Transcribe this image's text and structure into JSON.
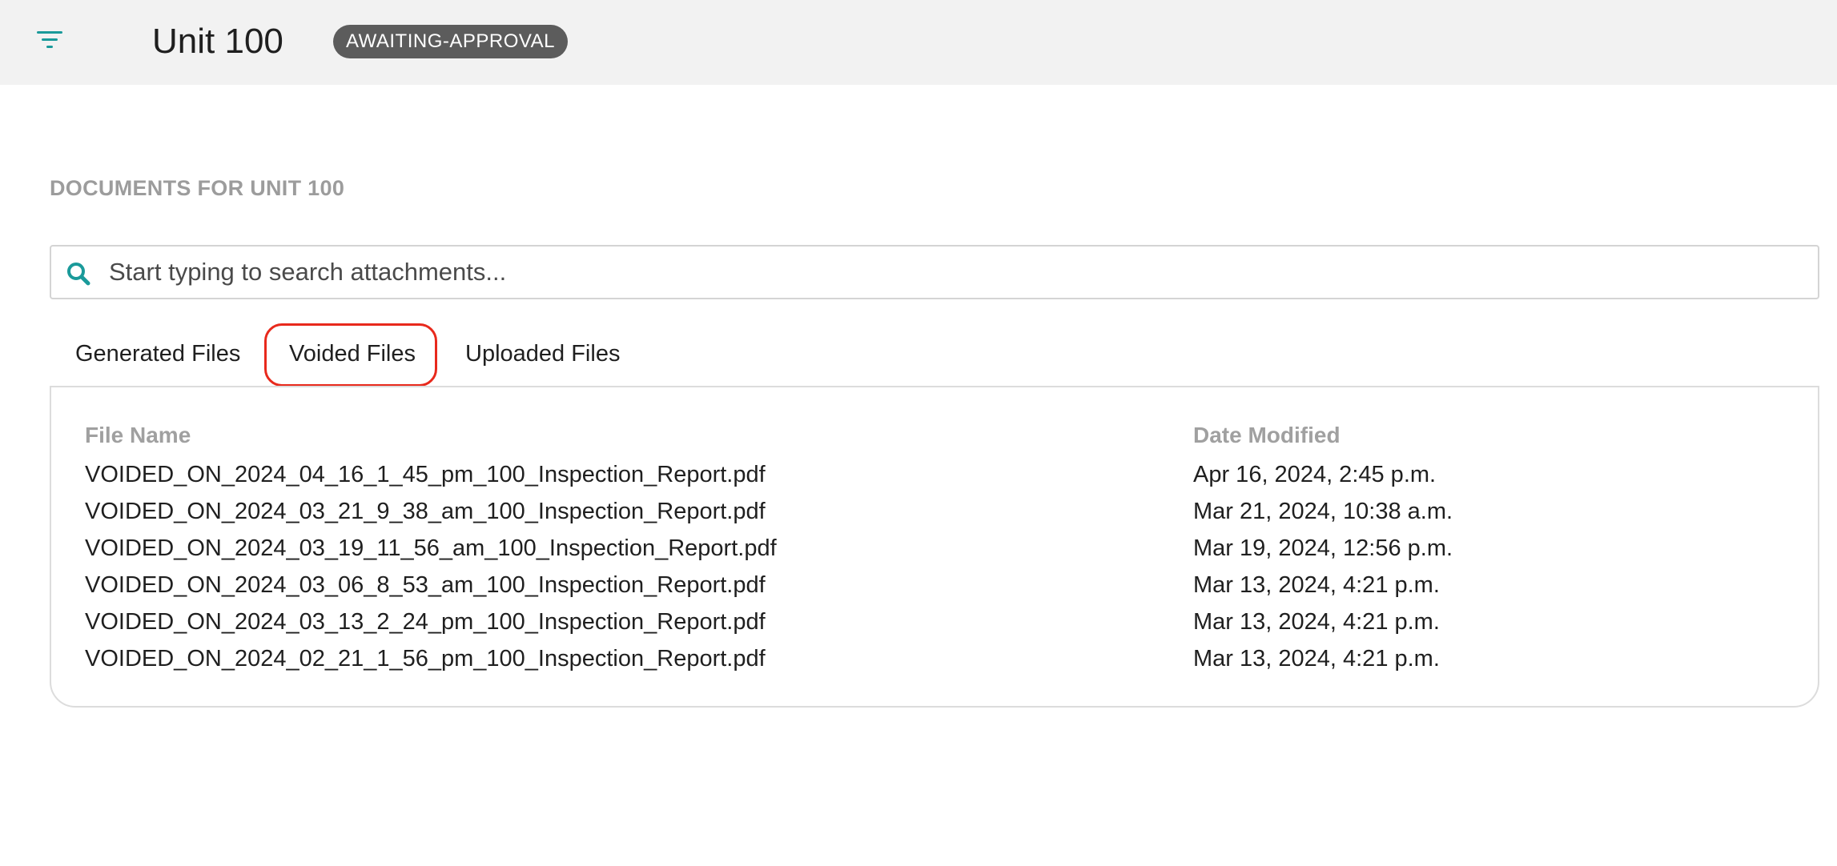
{
  "header": {
    "title": "Unit 100",
    "status": "AWAITING-APPROVAL",
    "menu_icon": "filter-menu-icon",
    "accent_color": "#1a9a9a"
  },
  "documents": {
    "heading": "DOCUMENTS FOR UNIT 100",
    "search": {
      "placeholder": "Start typing to search attachments...",
      "value": "",
      "icon": "search-icon"
    },
    "tabs": [
      {
        "label": "Generated Files",
        "active": false
      },
      {
        "label": "Voided Files",
        "active": true
      },
      {
        "label": "Uploaded Files",
        "active": false
      }
    ],
    "table": {
      "columns": [
        "File Name",
        "Date Modified"
      ],
      "rows": [
        {
          "name": "VOIDED_ON_2024_04_16_1_45_pm_100_Inspection_Report.pdf",
          "date": "Apr 16, 2024, 2:45 p.m."
        },
        {
          "name": "VOIDED_ON_2024_03_21_9_38_am_100_Inspection_Report.pdf",
          "date": "Mar 21, 2024, 10:38 a.m."
        },
        {
          "name": "VOIDED_ON_2024_03_19_11_56_am_100_Inspection_Report.pdf",
          "date": "Mar 19, 2024, 12:56 p.m."
        },
        {
          "name": "VOIDED_ON_2024_03_06_8_53_am_100_Inspection_Report.pdf",
          "date": "Mar 13, 2024, 4:21 p.m."
        },
        {
          "name": "VOIDED_ON_2024_03_13_2_24_pm_100_Inspection_Report.pdf",
          "date": "Mar 13, 2024, 4:21 p.m."
        },
        {
          "name": "VOIDED_ON_2024_02_21_1_56_pm_100_Inspection_Report.pdf",
          "date": "Mar 13, 2024, 4:21 p.m."
        }
      ]
    }
  }
}
